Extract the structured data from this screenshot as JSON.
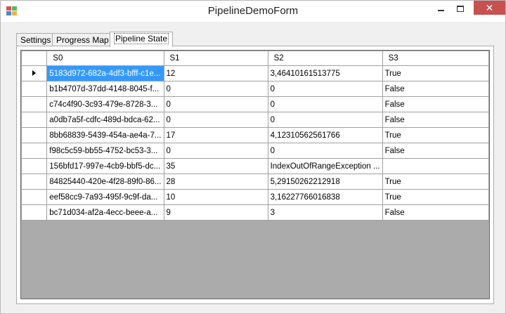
{
  "window": {
    "title": "PipelineDemoForm",
    "close_glyph": "✕"
  },
  "colors": {
    "selection": "#3399ff",
    "close_button": "#c75050",
    "grid_background": "#ababab"
  },
  "tabs": [
    {
      "label": "Settings"
    },
    {
      "label": "Progress Map"
    },
    {
      "label": "Pipeline State",
      "selected": true
    }
  ],
  "grid": {
    "columns": [
      "S0",
      "S1",
      "S2",
      "S3"
    ],
    "current_row_indicator": "row-pointer-icon",
    "rows": [
      [
        "5183d972-682a-4df3-bfff-c1e...",
        "12",
        "3,46410161513775",
        "True"
      ],
      [
        "b1b4707d-37dd-4148-8045-f...",
        "0",
        "0",
        "False"
      ],
      [
        "c74c4f90-3c93-479e-8728-3...",
        "0",
        "0",
        "False"
      ],
      [
        "a0db7a5f-cdfc-489d-bdca-62...",
        "0",
        "0",
        "False"
      ],
      [
        "8bb68839-5439-454a-ae4a-7...",
        "17",
        "4,12310562561766",
        "True"
      ],
      [
        "f98c5c59-bb55-4752-bc53-3...",
        "0",
        "0",
        "False"
      ],
      [
        "156bfd17-997e-4cb9-bbf5-dc...",
        "35",
        "IndexOutOfRangeException ...",
        ""
      ],
      [
        "84825440-420e-4f28-89f0-86...",
        "28",
        "5,29150262212918",
        "True"
      ],
      [
        "eef58cc9-7a93-495f-9c9f-da...",
        "10",
        "3,16227766016838",
        "True"
      ],
      [
        "bc71d034-af2a-4ecc-beee-a...",
        "9",
        "3",
        "False"
      ]
    ]
  }
}
